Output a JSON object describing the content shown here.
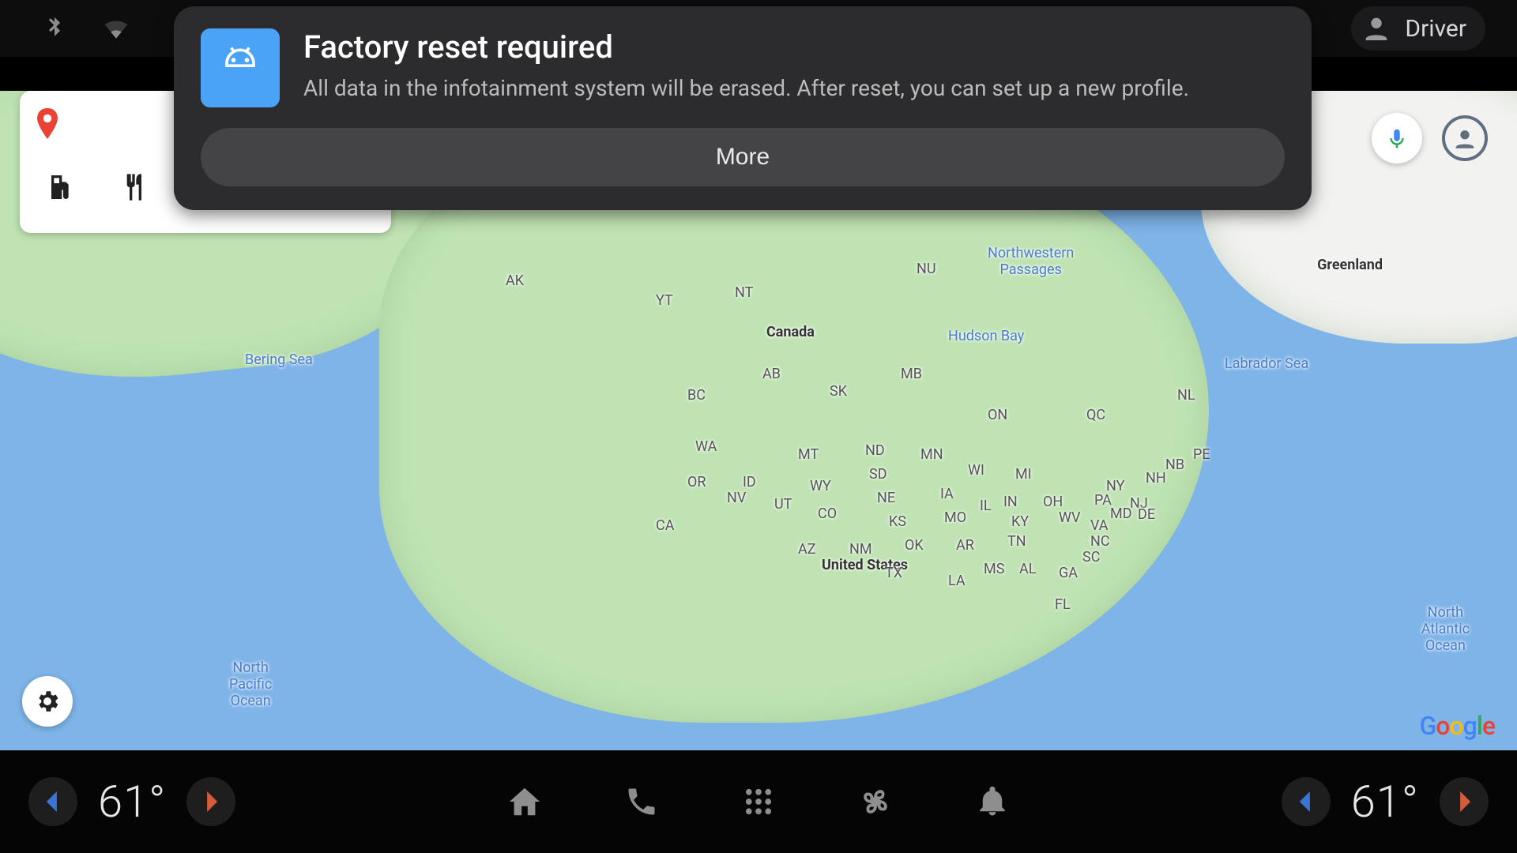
{
  "status": {
    "profile_name": "Driver"
  },
  "search": {
    "placeholder": ""
  },
  "notification": {
    "title": "Factory reset required",
    "body": "All data in the infotainment system will be erased. After reset, you can set up a new profile.",
    "button": "More"
  },
  "climate": {
    "left_temp": "61°",
    "right_temp": "61°"
  },
  "map": {
    "attribution": "Google",
    "labels": {
      "canada": "Canada",
      "usa": "United States",
      "greenland": "Greenland",
      "bering": "Bering Sea",
      "hudson": "Hudson Bay",
      "nw_pass": "Northwestern\nPassages",
      "labrador": "Labrador Sea",
      "n_atl": "North\nAtlantic\nOcean",
      "n_pac": "North\nPacific\nOcean",
      "ak": "AK",
      "yt": "YT",
      "nt": "NT",
      "nu": "NU",
      "bc": "BC",
      "ab": "AB",
      "sk": "SK",
      "mb": "MB",
      "on": "ON",
      "qc": "QC",
      "nl": "NL",
      "wa": "WA",
      "or": "OR",
      "id": "ID",
      "mt": "MT",
      "wy": "WY",
      "nv": "NV",
      "ut": "UT",
      "ca": "CA",
      "az": "AZ",
      "nm": "NM",
      "nd": "ND",
      "sd": "SD",
      "ne": "NE",
      "ks": "KS",
      "ok": "OK",
      "tx": "TX",
      "mn": "MN",
      "ia": "IA",
      "mo": "MO",
      "ar": "AR",
      "la": "LA",
      "wi": "WI",
      "il": "IL",
      "in": "IN",
      "ky": "KY",
      "tn": "TN",
      "ms": "MS",
      "al": "AL",
      "mi": "MI",
      "oh": "OH",
      "wv": "WV",
      "va": "VA",
      "nc": "NC",
      "sc": "SC",
      "ga": "GA",
      "fl": "FL",
      "ny": "NY",
      "pa": "PA",
      "nj": "NJ",
      "de": "DE",
      "md": "MD",
      "nh": "NH",
      "pe": "PE",
      "nb": "NB",
      "co": "CO"
    }
  }
}
